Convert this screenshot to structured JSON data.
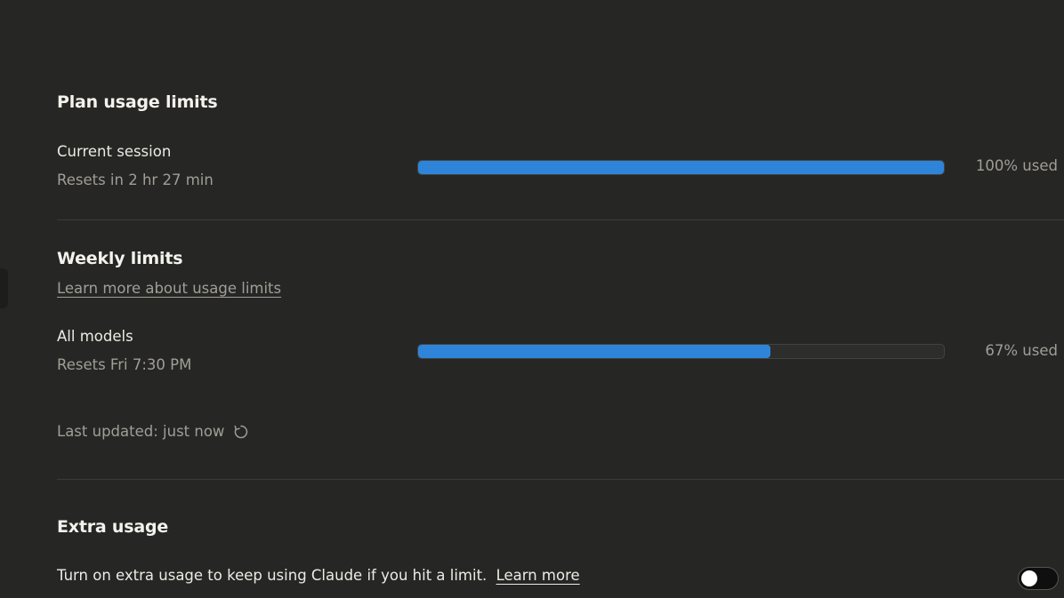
{
  "plan": {
    "title": "Plan usage limits",
    "session": {
      "label": "Current session",
      "resets": "Resets in 2 hr 27 min",
      "used_fraction": 1.0,
      "used_text": "100% used"
    }
  },
  "weekly": {
    "title": "Weekly limits",
    "learn_more": "Learn more about usage limits",
    "all_models": {
      "label": "All models",
      "resets": "Resets Fri 7:30 PM",
      "used_fraction": 0.67,
      "used_text": "67% used"
    },
    "last_updated": "Last updated: just now"
  },
  "extra": {
    "title": "Extra usage",
    "description": "Turn on extra usage to keep using Claude if you hit a limit.",
    "learn_more": "Learn more",
    "toggle_on": false
  },
  "colors": {
    "accent": "#2e84d9",
    "background": "#262624"
  },
  "icons": {
    "refresh": "refresh-icon"
  }
}
